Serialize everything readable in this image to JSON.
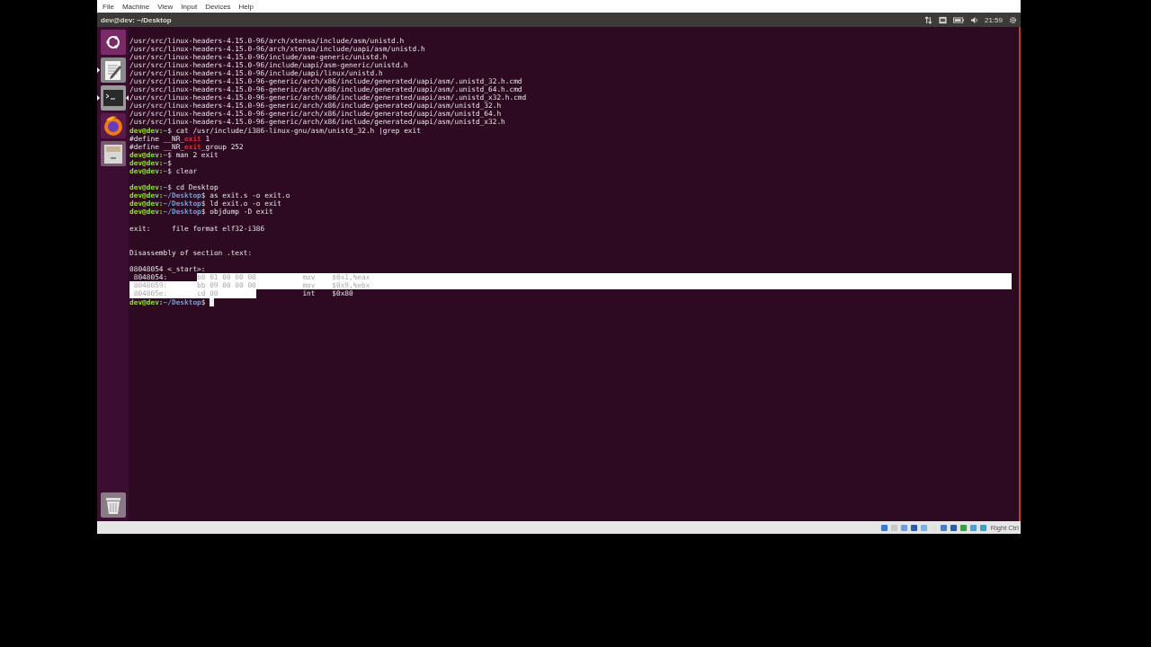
{
  "menu_bar": [
    "File",
    "Machine",
    "View",
    "Input",
    "Devices",
    "Help"
  ],
  "top_bar": {
    "title": "dev@dev: ~/Desktop",
    "clock": "21:59"
  },
  "launcher": [
    {
      "kind": "dash",
      "running": false,
      "focused": false
    },
    {
      "kind": "editor",
      "running": true,
      "focused": false
    },
    {
      "kind": "terminal",
      "running": true,
      "focused": true
    },
    {
      "kind": "browser",
      "running": false,
      "focused": false
    },
    {
      "kind": "files",
      "running": false,
      "focused": false
    },
    {
      "kind": "trash",
      "running": false,
      "focused": false
    }
  ],
  "terminal": {
    "lines": [
      {
        "kind": "text",
        "text": "/usr/src/linux-headers-4.15.0-96/arch/xtensa/include/asm/unistd.h"
      },
      {
        "kind": "text",
        "text": "/usr/src/linux-headers-4.15.0-96/arch/xtensa/include/uapi/asm/unistd.h"
      },
      {
        "kind": "text",
        "text": "/usr/src/linux-headers-4.15.0-96/include/asm-generic/unistd.h"
      },
      {
        "kind": "text",
        "text": "/usr/src/linux-headers-4.15.0-96/include/uapi/asm-generic/unistd.h"
      },
      {
        "kind": "text",
        "text": "/usr/src/linux-headers-4.15.0-96/include/uapi/linux/unistd.h"
      },
      {
        "kind": "text",
        "text": "/usr/src/linux-headers-4.15.0-96-generic/arch/x86/include/generated/uapi/asm/.unistd_32.h.cmd"
      },
      {
        "kind": "text",
        "text": "/usr/src/linux-headers-4.15.0-96-generic/arch/x86/include/generated/uapi/asm/.unistd_64.h.cmd"
      },
      {
        "kind": "text",
        "text": "/usr/src/linux-headers-4.15.0-96-generic/arch/x86/include/generated/uapi/asm/.unistd_x32.h.cmd"
      },
      {
        "kind": "text",
        "text": "/usr/src/linux-headers-4.15.0-96-generic/arch/x86/include/generated/uapi/asm/unistd_32.h"
      },
      {
        "kind": "text",
        "text": "/usr/src/linux-headers-4.15.0-96-generic/arch/x86/include/generated/uapi/asm/unistd_64.h"
      },
      {
        "kind": "text",
        "text": "/usr/src/linux-headers-4.15.0-96-generic/arch/x86/include/generated/uapi/asm/unistd_x32.h"
      },
      {
        "kind": "prompt",
        "user": "dev@dev:",
        "path": "~",
        "command": "$ cat /usr/include/i386-linux-gnu/asm/unistd_32.h |grep exit",
        "cursor": false
      },
      {
        "kind": "grep",
        "before": "#define __NR_",
        "match": "exit",
        "after": " 1"
      },
      {
        "kind": "grep",
        "before": "#define __NR_",
        "match": "exit",
        "after": "_group 252"
      },
      {
        "kind": "prompt",
        "user": "dev@dev:",
        "path": "~",
        "command": "$ man 2 exit",
        "cursor": false
      },
      {
        "kind": "prompt",
        "user": "dev@dev:",
        "path": "~",
        "command": "$",
        "cursor": false
      },
      {
        "kind": "prompt",
        "user": "dev@dev:",
        "path": "~",
        "command": "$ clear",
        "cursor": false
      },
      {
        "kind": "blank"
      },
      {
        "kind": "prompt",
        "user": "dev@dev:",
        "path": "~",
        "command": "$ cd Desktop",
        "cursor": false
      },
      {
        "kind": "prompt",
        "user": "dev@dev:",
        "path": "~/Desktop",
        "command": "$ as exit.s -o exit.o",
        "cursor": false
      },
      {
        "kind": "prompt",
        "user": "dev@dev:",
        "path": "~/Desktop",
        "command": "$ ld exit.o -o exit",
        "cursor": false
      },
      {
        "kind": "prompt",
        "user": "dev@dev:",
        "path": "~/Desktop",
        "command": "$ objdump -D exit",
        "cursor": false
      },
      {
        "kind": "blank"
      },
      {
        "kind": "text",
        "text": "exit:     file format elf32-i386"
      },
      {
        "kind": "blank"
      },
      {
        "kind": "blank"
      },
      {
        "kind": "text",
        "text": "Disassembly of section .text:"
      },
      {
        "kind": "blank"
      },
      {
        "kind": "text",
        "text": "08048054 <_start>:"
      },
      {
        "kind": "asm",
        "cells": [
          {
            "text": " 8048054:",
            "selected": false
          },
          {
            "text": "b8 01 00 00 00",
            "selected": true
          },
          {
            "text": "mov",
            "selected": true
          },
          {
            "text": "$0x1,%eax",
            "selected": true
          }
        ]
      },
      {
        "kind": "asm",
        "cells": [
          {
            "text": " 8048059:",
            "selected": true
          },
          {
            "text": "bb 09 00 00 00",
            "selected": true
          },
          {
            "text": "mov",
            "selected": true
          },
          {
            "text": "$0x9,%ebx",
            "selected": true
          }
        ]
      },
      {
        "kind": "asm",
        "cells": [
          {
            "text": " 804805e:",
            "selected": true
          },
          {
            "text": "cd 80",
            "selected": true
          },
          {
            "text": "int",
            "selected": false
          },
          {
            "text": "$0x80",
            "selected": false
          }
        ]
      },
      {
        "kind": "prompt",
        "user": "dev@dev:",
        "path": "~/Desktop",
        "command": "$",
        "cursor": true
      }
    ]
  },
  "status_bar": {
    "host_key": "Right Ctrl"
  }
}
